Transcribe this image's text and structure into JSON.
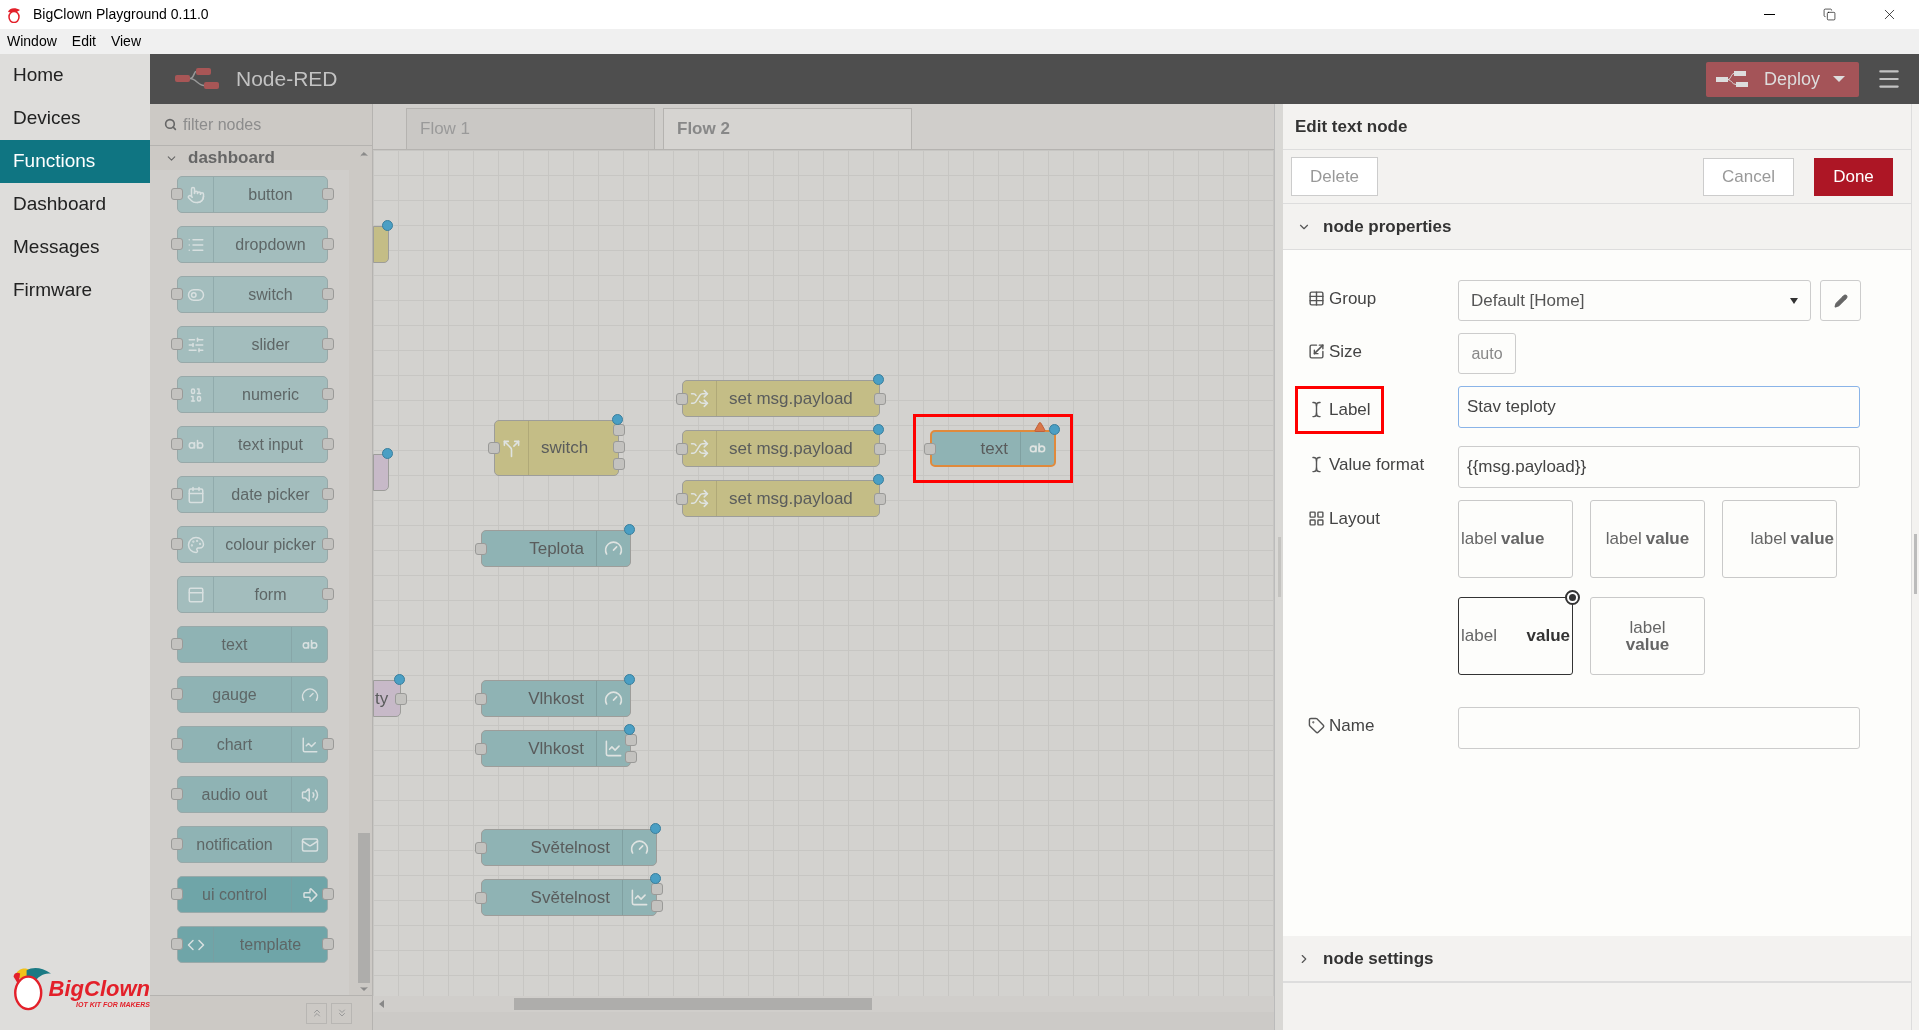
{
  "window": {
    "title": "BigClown Playground 0.11.0"
  },
  "menu_bar": [
    "Window",
    "Edit",
    "View"
  ],
  "nav": [
    {
      "label": "Home",
      "selected": false
    },
    {
      "label": "Devices",
      "selected": false
    },
    {
      "label": "Functions",
      "selected": true
    },
    {
      "label": "Dashboard",
      "selected": false
    },
    {
      "label": "Messages",
      "selected": false
    },
    {
      "label": "Firmware",
      "selected": false
    }
  ],
  "brand": {
    "name": "BigClown",
    "tagline": "IOT KIT FOR MAKERS"
  },
  "header": {
    "title": "Node-RED",
    "deploy": "Deploy"
  },
  "palette": {
    "placeholder": "filter nodes",
    "category": "dashboard",
    "expanded": true,
    "nodes": [
      {
        "label": "button",
        "kind": "button",
        "input": true,
        "output": true,
        "color": "#a3bdbd"
      },
      {
        "label": "dropdown",
        "kind": "dropdown",
        "input": true,
        "output": true,
        "color": "#a3bdbd"
      },
      {
        "label": "switch",
        "kind": "switch",
        "input": true,
        "output": true,
        "color": "#a3bdbd"
      },
      {
        "label": "slider",
        "kind": "slider",
        "input": true,
        "output": true,
        "color": "#a3bdbd"
      },
      {
        "label": "numeric",
        "kind": "numeric",
        "input": true,
        "output": true,
        "color": "#a3bdbd"
      },
      {
        "label": "text input",
        "kind": "text_input",
        "input": true,
        "output": true,
        "color": "#a3bdbd"
      },
      {
        "label": "date picker",
        "kind": "date",
        "input": true,
        "output": true,
        "color": "#a3bdbd"
      },
      {
        "label": "colour picker",
        "kind": "colour",
        "input": true,
        "output": true,
        "color": "#a3bdbd"
      },
      {
        "label": "form",
        "kind": "form",
        "input": false,
        "output": true,
        "color": "#a3bdbd"
      },
      {
        "label": "text",
        "kind": "text",
        "input": true,
        "output": false,
        "color": "#8fb3b4"
      },
      {
        "label": "gauge",
        "kind": "gauge",
        "input": true,
        "output": false,
        "color": "#8fb3b4"
      },
      {
        "label": "chart",
        "kind": "chart",
        "input": true,
        "output": true,
        "color": "#8fb3b4"
      },
      {
        "label": "audio out",
        "kind": "audio",
        "input": true,
        "output": false,
        "color": "#8fb3b4"
      },
      {
        "label": "notification",
        "kind": "notification",
        "input": true,
        "output": false,
        "color": "#8fb3b4"
      },
      {
        "label": "ui control",
        "kind": "control",
        "input": true,
        "output": true,
        "color": "#6fa5a8"
      },
      {
        "label": "template",
        "kind": "template",
        "input": true,
        "output": true,
        "color": "#6fa5a8"
      }
    ]
  },
  "tabs": [
    {
      "label": "Flow 1",
      "selected": false
    },
    {
      "label": "Flow 2",
      "selected": true
    }
  ],
  "canvas": {
    "nodes": [
      {
        "kind": "change",
        "color": "#c4bd86",
        "changed": true,
        "selected": false,
        "warning": false
      },
      {
        "kind": "function",
        "color": "#c7b9c8",
        "changed": true,
        "selected": false,
        "warning": false
      },
      {
        "kind": "function",
        "label": "ty",
        "color": "#c7b9c8",
        "changed": true,
        "selected": false,
        "warning": false
      },
      {
        "kind": "switch",
        "label": "switch",
        "color": "#c4bd86",
        "changed": true,
        "selected": false,
        "warning": false
      },
      {
        "kind": "change",
        "label": "set msg.payload",
        "color": "#c4bd86",
        "changed": true,
        "selected": false,
        "warning": false
      },
      {
        "kind": "change",
        "label": "set msg.payload",
        "color": "#c4bd86",
        "changed": true,
        "selected": false,
        "warning": false
      },
      {
        "kind": "change",
        "label": "set msg.payload",
        "color": "#c4bd86",
        "changed": true,
        "selected": false,
        "warning": false
      },
      {
        "kind": "text",
        "label": "text",
        "color": "#8fb3b4",
        "changed": true,
        "selected": true,
        "warning": true,
        "highlighted": true
      },
      {
        "kind": "gauge",
        "label": "Teplota",
        "color": "#8fb3b4",
        "changed": true,
        "selected": false,
        "warning": false
      },
      {
        "kind": "gauge",
        "label": "Vlhkost",
        "color": "#8fb3b4",
        "changed": true,
        "selected": false,
        "warning": false
      },
      {
        "kind": "chart",
        "label": "Vlhkost",
        "color": "#8fb3b4",
        "changed": true,
        "selected": false,
        "warning": false
      },
      {
        "kind": "gauge",
        "label": "Světelnost",
        "color": "#8fb3b4",
        "changed": true,
        "selected": false,
        "warning": false
      },
      {
        "kind": "chart",
        "label": "Světelnost",
        "color": "#8fb3b4",
        "changed": true,
        "selected": false,
        "warning": false
      }
    ]
  },
  "editor": {
    "title": "Edit text node",
    "delete": "Delete",
    "cancel": "Cancel",
    "done": "Done",
    "sections": [
      {
        "title": "node properties",
        "expanded": true,
        "fields": [
          {
            "kind": "select",
            "label": "Group",
            "value": "Default [Home]"
          },
          {
            "kind": "size",
            "label": "Size",
            "value": "auto"
          },
          {
            "kind": "text",
            "label": "Label",
            "value": "Stav teploty",
            "focused": true,
            "highlighted": true
          },
          {
            "kind": "text",
            "label": "Value format",
            "value": "{{msg.payload}}",
            "focused": false
          },
          {
            "kind": "layout",
            "label": "Layout",
            "options": [
              {
                "label": "label",
                "value": "value",
                "kind": "left",
                "selected": false
              },
              {
                "label": "label",
                "value": "value",
                "kind": "center",
                "selected": false
              },
              {
                "label": "label",
                "value": "value",
                "kind": "right",
                "selected": false
              },
              {
                "label": "label",
                "value": "value",
                "kind": "spread",
                "selected": true
              },
              {
                "label": "label",
                "value": "value",
                "kind": "stacked",
                "selected": false
              }
            ]
          },
          {
            "kind": "text",
            "label": "Name",
            "focused": false
          }
        ]
      },
      {
        "title": "node settings",
        "expanded": false
      }
    ]
  }
}
